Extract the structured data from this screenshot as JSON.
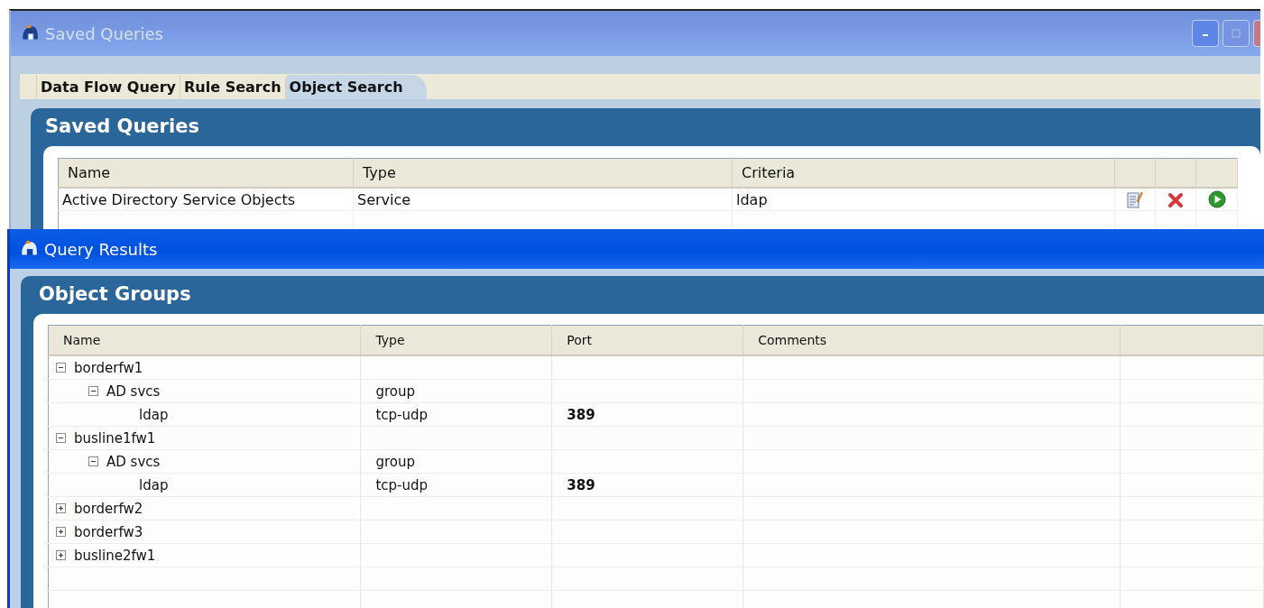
{
  "saved_window": {
    "title": "Saved Queries",
    "active": false,
    "tabs": [
      {
        "label": "Data Flow Query",
        "selected": false
      },
      {
        "label": "Rule Search",
        "selected": false
      },
      {
        "label": "Object Search",
        "selected": true
      }
    ],
    "panel_title": "Saved Queries",
    "columns": [
      "Name",
      "Type",
      "Criteria"
    ],
    "rows": [
      {
        "name": "Active Directory Service Objects",
        "type": "Service",
        "criteria": "ldap"
      }
    ]
  },
  "results_window": {
    "title": "Query Results",
    "active": true,
    "panel_title": "Object Groups",
    "columns": [
      "Name",
      "Type",
      "Port",
      "Comments"
    ],
    "rows": [
      {
        "name": "borderfw1",
        "expanded": true,
        "children": [
          {
            "name": "AD  svcs",
            "type": "group",
            "expanded": true,
            "children": [
              {
                "name": "ldap",
                "type": "tcp-udp",
                "port": "389"
              }
            ]
          }
        ]
      },
      {
        "name": "busline1fw1",
        "expanded": true,
        "children": [
          {
            "name": "AD  svcs",
            "type": "group",
            "expanded": true,
            "children": [
              {
                "name": "ldap",
                "type": "tcp-udp",
                "port": "389"
              }
            ]
          }
        ]
      },
      {
        "name": "borderfw2",
        "expanded": false
      },
      {
        "name": "borderfw3",
        "expanded": false
      },
      {
        "name": "busline2fw1",
        "expanded": false
      }
    ]
  }
}
